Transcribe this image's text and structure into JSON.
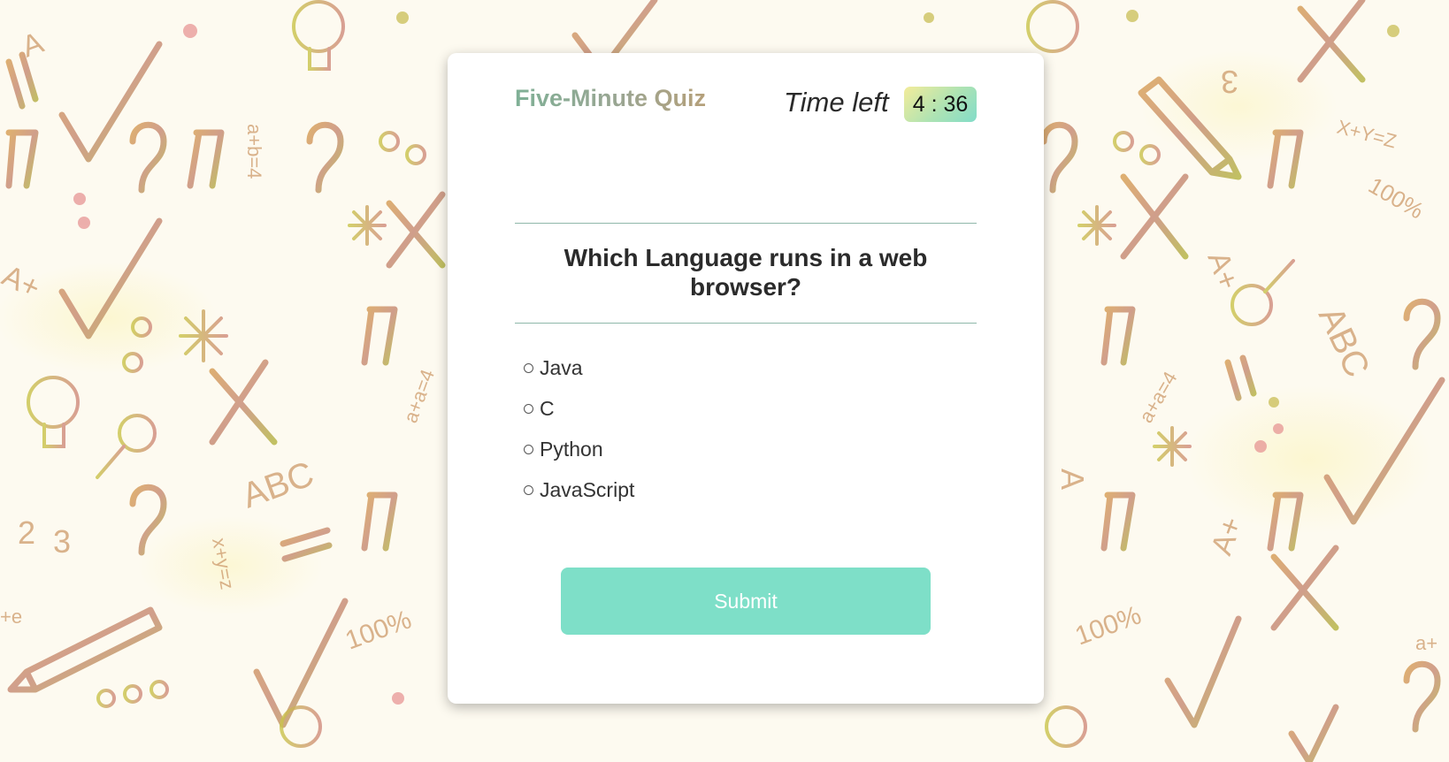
{
  "quiz": {
    "title": "Five-Minute Quiz",
    "timer_label": "Time left",
    "timer_value": "4 : 36"
  },
  "question": {
    "text": "Which Language runs in a web browser?",
    "options": [
      "Java",
      "C",
      "Python",
      "JavaScript"
    ],
    "selected": null
  },
  "submit": {
    "label": "Submit"
  },
  "colors": {
    "accent": "#7edfc8",
    "divider": "#8fb8aa",
    "timer_gradient_start": "#f3ec9a",
    "timer_gradient_end": "#82dcc9"
  },
  "background": {
    "pattern": "hand-drawn doodles: checkmarks, question marks, exclamation marks, crosses, light bulbs, pencils, ABC letters, math formulas"
  }
}
